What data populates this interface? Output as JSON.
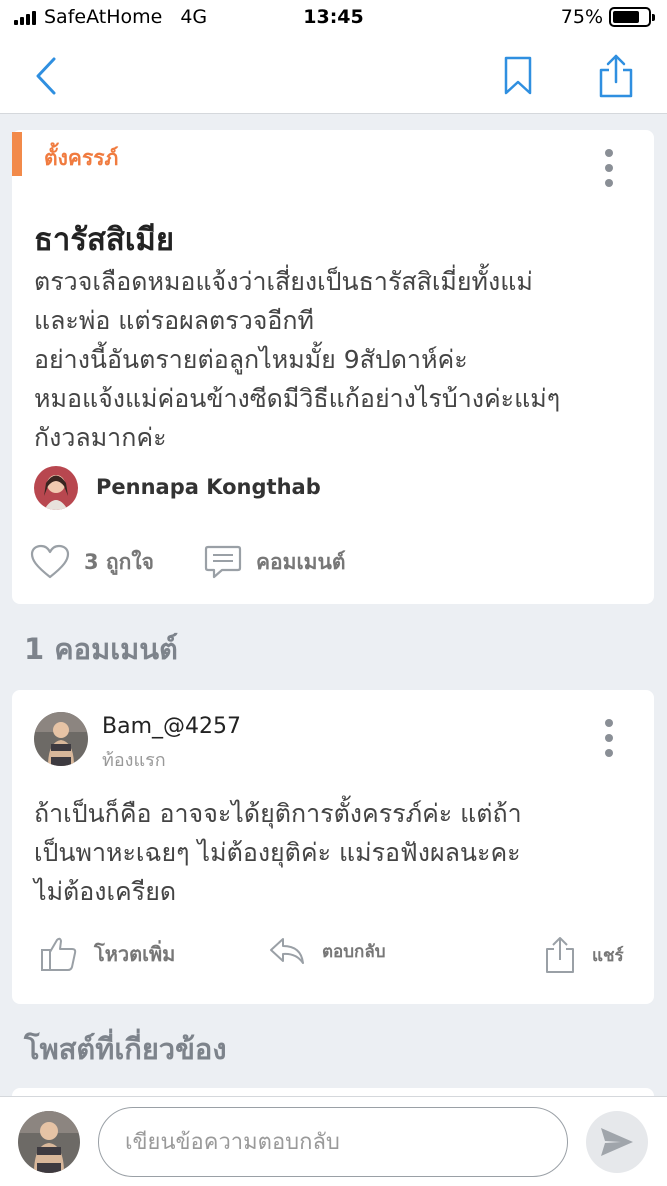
{
  "status_bar": {
    "carrier": "SafeAtHome",
    "network": "4G",
    "time": "13:45",
    "battery_percent": "75%",
    "battery_level": 0.75
  },
  "nav": {
    "back_icon": "chevron-left-icon",
    "bookmark_icon": "bookmark-icon",
    "share_icon": "share-icon",
    "accent_color": "#2f8fe0"
  },
  "post": {
    "tag": "ตั้งครรภ์",
    "title": "ธารัสสิเมีย",
    "body_lines": [
      "ตรวจเลือดหมอแจ้งว่าเสี่ยงเป็นธารัสสิเมี่ยทั้งแม่",
      "และพ่อ แต่รอผลตรวจอีกที",
      "อย่างนี้อันตรายต่อลูกไหมมั้ย 9สัปดาห์ค่ะ",
      "หมอแจ้งแม่ค่อนข้างซีดมีวิธีแก้อย่างไรบ้างค่ะแม่ๆ",
      "กังวลมากค่ะ"
    ],
    "author": "Pennapa Kongthab",
    "likes": "3 ถูกใจ",
    "comment_label": "คอมเมนต์",
    "tag_color": "#f07b3f"
  },
  "comments_header": "1 คอมเมนต์",
  "comment": {
    "author": "Bam_@4257",
    "subtitle": "ท้องแรก",
    "body_lines": [
      "ถ้าเป็นก็คือ อาจจะได้ยุติการตั้งครรภ์ค่ะ แต่ถ้า",
      "เป็นพาหะเฉยๆ ไม่ต้องยุติค่ะ แม่รอฟังผลนะคะ",
      "ไม่ต้องเครียด"
    ],
    "vote_label": "โหวตเพิ่ม",
    "reply_label": "ตอบกลับ",
    "share_label": "แชร์"
  },
  "related_header": "โพสต์ที่เกี่ยวข้อง",
  "reply_bar": {
    "placeholder": "เขียนข้อความตอบกลับ",
    "send_icon": "send-icon"
  }
}
